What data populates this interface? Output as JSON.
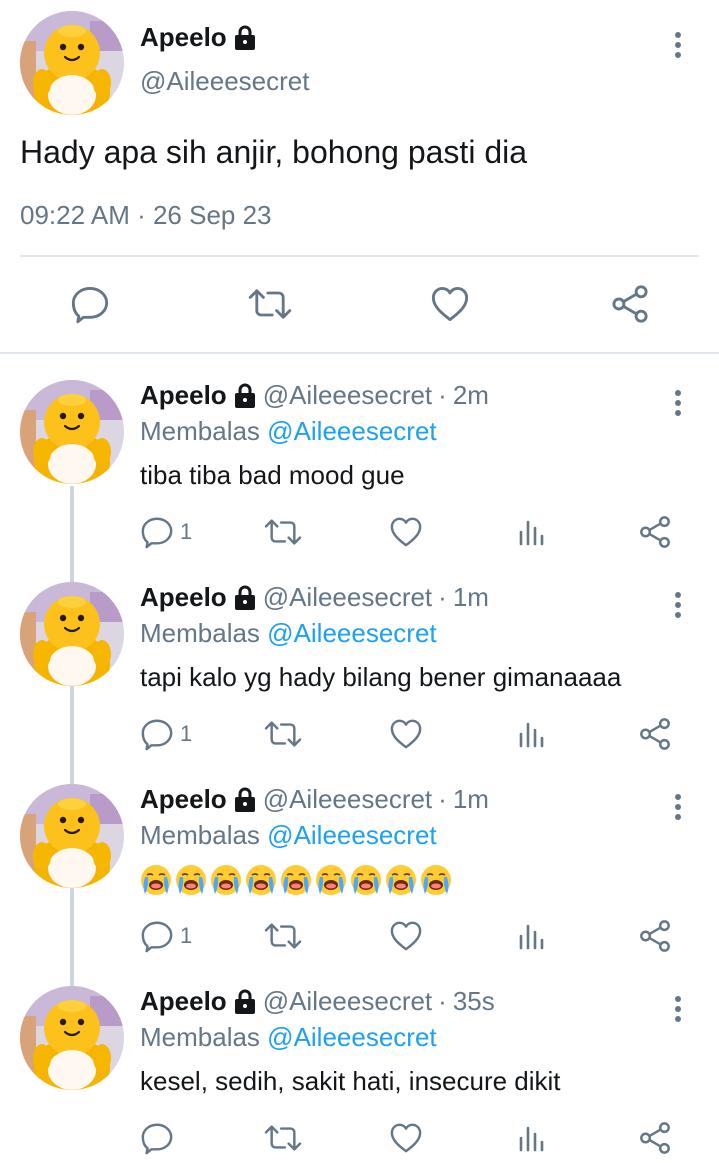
{
  "main_tweet": {
    "display_name": "Apeelo",
    "handle": "@Aileeesecret",
    "text": "Hady apa sih anjir, bohong pasti dia",
    "timestamp": "09:22 AM · 26 Sep 23"
  },
  "replies": [
    {
      "display_name": "Apeelo",
      "handle": "@Aileeesecret",
      "time": "2m",
      "reply_label": "Membalas",
      "reply_to": "@Aileeesecret",
      "text": "tiba tiba bad mood gue",
      "reply_count": "1"
    },
    {
      "display_name": "Apeelo",
      "handle": "@Aileeesecret",
      "time": "1m",
      "reply_label": "Membalas",
      "reply_to": "@Aileeesecret",
      "text": "tapi kalo yg hady bilang bener gimanaaaa",
      "reply_count": "1"
    },
    {
      "display_name": "Apeelo",
      "handle": "@Aileeesecret",
      "time": "1m",
      "reply_label": "Membalas",
      "reply_to": "@Aileeesecret",
      "text": "😭😭😭😭😭😭😭😭😭",
      "emoji_count": 9,
      "reply_count": "1"
    },
    {
      "display_name": "Apeelo",
      "handle": "@Aileeesecret",
      "time": "35s",
      "reply_label": "Membalas",
      "reply_to": "@Aileeesecret",
      "text": "kesel, sedih, sakit hati, insecure dikit",
      "reply_count": ""
    }
  ],
  "colors": {
    "text_primary": "#14171a",
    "text_secondary": "#657786",
    "link": "#1da1f2",
    "divider": "#e1e8ed",
    "icon": "#657786"
  },
  "icons": {
    "lock": "lock-icon",
    "more": "more-vertical-icon",
    "reply": "comment-icon",
    "retweet": "retweet-icon",
    "like": "heart-icon",
    "share": "share-icon",
    "analytics": "analytics-icon"
  }
}
